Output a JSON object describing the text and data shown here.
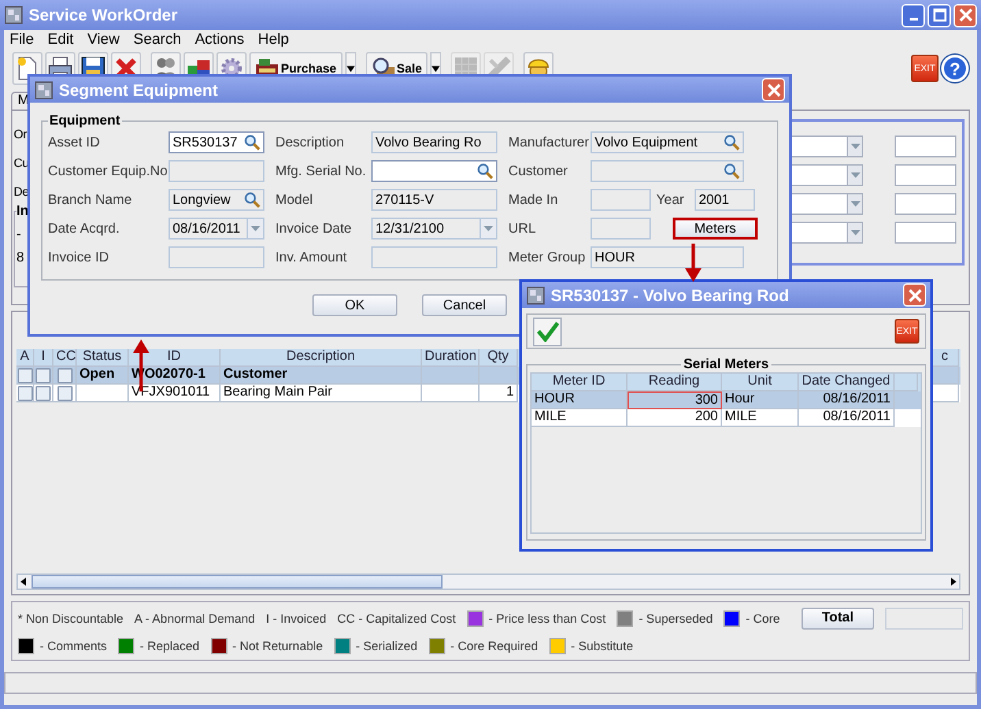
{
  "main_window": {
    "title": "Service WorkOrder",
    "menu": [
      "File",
      "Edit",
      "View",
      "Search",
      "Actions",
      "Help"
    ],
    "toolbar": [
      {
        "kind": "new",
        "disabled": false
      },
      {
        "kind": "print",
        "disabled": false
      },
      {
        "kind": "save",
        "disabled": false
      },
      {
        "kind": "delete",
        "disabled": false
      },
      {
        "kind": "people",
        "disabled": false
      },
      {
        "kind": "boxes",
        "disabled": false
      },
      {
        "kind": "gear",
        "disabled": false
      },
      {
        "kind": "purchase",
        "label": "Purchase",
        "dropdown": true,
        "disabled": false
      },
      {
        "kind": "sale",
        "label": "Sale",
        "dropdown": true,
        "disabled": false
      },
      {
        "kind": "grid",
        "disabled": true
      },
      {
        "kind": "tools",
        "disabled": true
      },
      {
        "kind": "worker",
        "disabled": false
      }
    ],
    "toolbar_right": [
      {
        "kind": "exit",
        "label": "EXIT"
      },
      {
        "kind": "help",
        "label": "?"
      }
    ],
    "tabs": [
      {
        "label": "M",
        "selected": true
      }
    ],
    "form_labels": [
      "Or",
      "Cu",
      "De"
    ],
    "group": {
      "title": "In",
      "lines": [
        "-",
        "8"
      ]
    },
    "table": {
      "columns": [
        "A",
        "I",
        "CC",
        "Status",
        "ID",
        "Description",
        "Duration",
        "Qty",
        "c"
      ],
      "rows": [
        {
          "kind": "group",
          "selected": true,
          "a": false,
          "i": false,
          "cc": false,
          "status": "Open",
          "id": "WO02070-1",
          "description": "Customer"
        },
        {
          "kind": "item",
          "selected": false,
          "a": false,
          "i": false,
          "cc": false,
          "id": "VFJX901011",
          "description": "Bearing Main Pair",
          "qty": "1"
        }
      ]
    },
    "legend": [
      [
        {
          "text": "* Non Discountable"
        },
        {
          "text": "A - Abnormal Demand"
        },
        {
          "text": "I - Invoiced"
        },
        {
          "text": "CC - Capitalized Cost"
        },
        {
          "text": "- Price less than Cost",
          "color": "#9933e0"
        },
        {
          "text": "- Superseded",
          "color": "#808080"
        },
        {
          "text": "- Core",
          "color": "#0000ff"
        }
      ],
      [
        {
          "text": "- Comments",
          "color": "#000000"
        },
        {
          "text": "- Replaced",
          "color": "#008000"
        },
        {
          "text": "- Not Returnable",
          "color": "#800000"
        },
        {
          "text": "- Serialized",
          "color": "#008080"
        },
        {
          "text": "- Core Required",
          "color": "#808000"
        },
        {
          "text": "- Substitute",
          "color": "#ffcc00"
        }
      ]
    ],
    "total_button": "Total"
  },
  "segment_dialog": {
    "title": "Segment Equipment",
    "group_title": "Equipment",
    "rows": [
      {
        "left": {
          "label": "Asset ID",
          "field": {
            "value": "SR530137",
            "editable": true,
            "lookup": true,
            "dropdown": false
          }
        },
        "mid": {
          "label": "Description",
          "field": {
            "value": "Volvo Bearing Ro",
            "editable": false,
            "lookup": false,
            "dropdown": false
          }
        },
        "right": [
          {
            "kind": "label",
            "text": "Manufacturer"
          },
          {
            "kind": "field",
            "value": "Volvo Equipment",
            "editable": false,
            "lookup": true,
            "dropdown": false
          }
        ]
      },
      {
        "left": {
          "label": "Customer Equip.No",
          "field": {
            "editable": false,
            "lookup": false,
            "dropdown": false
          }
        },
        "mid": {
          "label": "Mfg. Serial No.",
          "field": {
            "editable": true,
            "lookup": true,
            "dropdown": false
          }
        },
        "right": [
          {
            "kind": "label",
            "text": "Customer"
          },
          {
            "kind": "field",
            "editable": false,
            "lookup": true,
            "dropdown": false
          }
        ]
      },
      {
        "left": {
          "label": "Branch Name",
          "field": {
            "value": "Longview",
            "editable": false,
            "lookup": true,
            "dropdown": false
          }
        },
        "mid": {
          "label": "Model",
          "field": {
            "value": "270115-V",
            "editable": false,
            "lookup": false,
            "dropdown": false
          }
        },
        "right": [
          {
            "kind": "label",
            "text": "Made In"
          },
          {
            "kind": "field",
            "editable": false,
            "lookup": false,
            "dropdown": false
          },
          {
            "kind": "label",
            "text": "Year"
          },
          {
            "kind": "field",
            "value": "2001",
            "editable": false,
            "lookup": false,
            "dropdown": false
          }
        ]
      },
      {
        "left": {
          "label": "Date Acqrd.",
          "field": {
            "value": "08/16/2011",
            "editable": false,
            "lookup": false,
            "dropdown": true
          }
        },
        "mid": {
          "label": "Invoice Date",
          "field": {
            "value": "12/31/2100",
            "editable": false,
            "lookup": false,
            "dropdown": true
          }
        },
        "right": [
          {
            "kind": "label",
            "text": "URL"
          },
          {
            "kind": "field",
            "editable": false,
            "lookup": false,
            "dropdown": false
          },
          {
            "kind": "button",
            "label": "Meters",
            "highlighted": true
          }
        ]
      },
      {
        "left": {
          "label": "Invoice ID",
          "field": {
            "editable": false,
            "lookup": false,
            "dropdown": false
          }
        },
        "mid": {
          "label": "Inv. Amount",
          "field": {
            "editable": false,
            "lookup": false,
            "dropdown": false
          }
        },
        "right": [
          {
            "kind": "label",
            "text": "Meter Group"
          },
          {
            "kind": "field",
            "value": "HOUR",
            "editable": false,
            "lookup": false,
            "dropdown": false
          }
        ]
      }
    ],
    "buttons": [
      "OK",
      "Cancel"
    ]
  },
  "meters_dialog": {
    "title": "SR530137 - Volvo Bearing Rod",
    "exit_label": "EXIT",
    "group_title": "Serial Meters",
    "columns": [
      "Meter ID",
      "Reading",
      "Unit",
      "Date Changed"
    ],
    "rows": [
      {
        "selected": true,
        "meter_id": "HOUR",
        "reading": "300",
        "reading_focused": true,
        "unit": "Hour",
        "date_changed": "08/16/2011"
      },
      {
        "selected": false,
        "meter_id": "MILE",
        "reading": "200",
        "reading_focused": false,
        "unit": "MILE",
        "date_changed": "08/16/2011"
      }
    ]
  }
}
